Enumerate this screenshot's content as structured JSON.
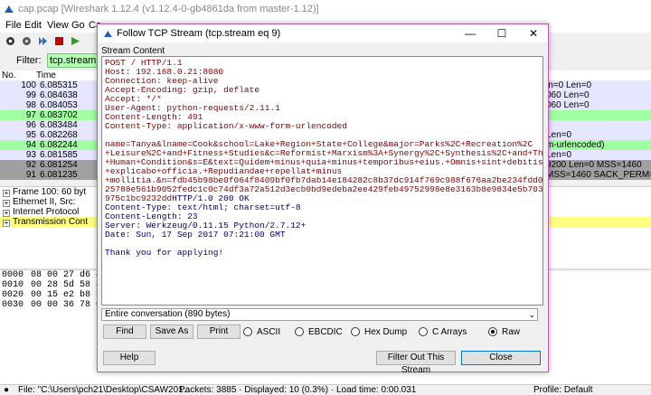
{
  "wireshark": {
    "title": "cap.pcap    [Wireshark 1.12.4  (v1.12.4-0-gb4861da from master-1.12)]",
    "menu": [
      "File",
      "Edit",
      "View",
      "Go",
      "Ca"
    ],
    "filter_label": "Filter:",
    "filter_value": "tcp.stream eq",
    "columns": [
      "No.",
      "Time"
    ],
    "packets": [
      {
        "no": "100",
        "time": "6.085315",
        "info": "in=0 Len=0",
        "bg": "#e7e6ff"
      },
      {
        "no": "99",
        "time": "6.084638",
        "info": "060 Len=0",
        "bg": "#e7e6ff"
      },
      {
        "no": "98",
        "time": "6.084053",
        "info": "060 Len=0",
        "bg": "#e7e6ff"
      },
      {
        "no": "97",
        "time": "6.083702",
        "info": "",
        "bg": "#a0ffa0"
      },
      {
        "no": "96",
        "time": "6.083484",
        "info": "",
        "bg": "#e7e6ff"
      },
      {
        "no": "95",
        "time": "6.082268",
        "info": "Len=0",
        "bg": "#e7e6ff"
      },
      {
        "no": "94",
        "time": "6.082244",
        "info": "m-urlencoded)",
        "bg": "#a0ffa0"
      },
      {
        "no": "93",
        "time": "6.081585",
        "info": "Len=0",
        "bg": "#e7e6ff"
      },
      {
        "no": "92",
        "time": "6.081254",
        "info": "9200 Len=0 MSS=1460",
        "bg": "#a0a0a0"
      },
      {
        "no": "91",
        "time": "6.081235",
        "info": "MSS=1460 SACK_PERM=",
        "bg": "#a0a0a0"
      }
    ],
    "details": [
      {
        "text": "Frame 100: 60 byt",
        "hl": false
      },
      {
        "text": "Ethernet II, Src:",
        "hl": false
      },
      {
        "text": "Internet Protocol",
        "hl": false
      },
      {
        "text": "Transmission Cont",
        "hl": true
      }
    ],
    "hex": [
      {
        "off": "0000",
        "bytes": "08 00 27 d6 a"
      },
      {
        "off": "0010",
        "bytes": "00 28 5d 58 4"
      },
      {
        "off": "0020",
        "bytes": "00 15 e2 b8 1"
      },
      {
        "off": "0030",
        "bytes": "00 00 36 78 0"
      }
    ],
    "status": {
      "file": "File: \"C:\\Users\\pch21\\Desktop\\CSAW201...",
      "packets": "Packets: 3885 · Displayed: 10 (0.3%) · Load time: 0:00.031",
      "profile": "Profile: Default"
    }
  },
  "dialog": {
    "title": "Follow TCP Stream (tcp.stream eq 9)",
    "stream_label": "Stream Content",
    "client_lines": [
      "POST / HTTP/1.1",
      "Host: 192.168.0.21:8080",
      "Connection: keep-alive",
      "Accept-Encoding: gzip, deflate",
      "Accept: */*",
      "User-Agent: python-requests/2.11.1",
      "Content-Length: 491",
      "Content-Type: application/x-www-form-urlencoded",
      "",
      "name=Tanya&lname=Cook&school=Lake+Region+State+College&major=Parks%2C+Recreation%2C",
      "+Leisure%2C+and+Fitness+Studies&c=Reformist+Marxism%3A+Synergy%2C+Synthesis%2C+and+The",
      "+Human+Condition&s=E&text=Quidem+minus+quia+minus+temporibus+eius.+Omnis+sint+debitis",
      "+explicabo+officia.+Repudiandae+repellat+minus",
      "+mollitia.&n=fdb45b98be0f064f8409bf0fb7dab14e184282c8b37dc914f769c988f676aa2be234fdd01574",
      "25788e561b9052fedc1c0c74df3a72a512d3ecb0bd9edeba2ee429feb49752998e8e3163b8e9834e5b703a750"
    ],
    "last_client_part": "975c1bc9232dd",
    "server_first_part": "HTTP/1.0 200 OK",
    "server_lines": [
      "Content-Type: text/html; charset=utf-8",
      "Content-Length: 23",
      "Server: Werkzeug/0.11.15 Python/2.7.12+",
      "Date: Sun, 17 Sep 2017 07:21:00 GMT",
      "",
      "Thank you for applying!"
    ],
    "conversation": "Entire conversation (890 bytes)",
    "buttons": {
      "find": "Find",
      "save_as": "Save As",
      "print": "Print",
      "help": "Help",
      "filter_out": "Filter Out This Stream",
      "close": "Close"
    },
    "formats": [
      {
        "label": "ASCII",
        "selected": false
      },
      {
        "label": "EBCDIC",
        "selected": false
      },
      {
        "label": "Hex Dump",
        "selected": false
      },
      {
        "label": "C Arrays",
        "selected": false
      },
      {
        "label": "Raw",
        "selected": true
      }
    ]
  }
}
